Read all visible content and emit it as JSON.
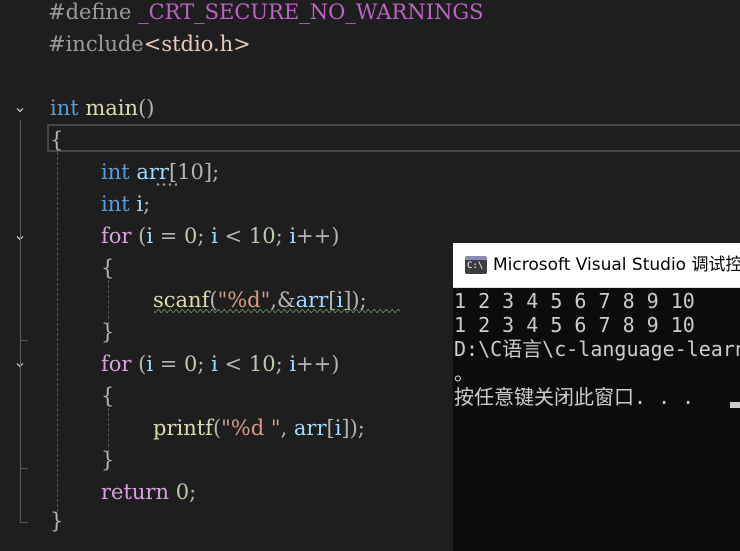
{
  "editor": {
    "lines": {
      "l1": {
        "a": "#define ",
        "b": "_CRT_SECURE_NO_WARNINGS"
      },
      "l2": {
        "a": "#include",
        "b": "<stdio.h>"
      },
      "l4": {
        "kw": "int",
        "fn": "main",
        "punc": "()"
      },
      "l5": {
        "punc": "{"
      },
      "l6": {
        "kw": "int",
        "var": "arr",
        "rest": "[10];"
      },
      "l7": {
        "kw": "int",
        "var": "i",
        "rest": ";"
      },
      "l8": {
        "kw": "for",
        "p1": " (",
        "v1": "i",
        "p2": " = ",
        "n1": "0",
        "p3": "; ",
        "v2": "i",
        "p4": " < ",
        "n2": "10",
        "p5": "; ",
        "v3": "i",
        "p6": "++)"
      },
      "l9": {
        "punc": "{"
      },
      "l10": {
        "fn": "scanf",
        "p1": "(",
        "str": "\"%d\"",
        "p2": ",&",
        "var": "arr",
        "p3": "[",
        "v2": "i",
        "p4": "]);"
      },
      "l11": {
        "punc": "}"
      },
      "l12": {
        "kw": "for",
        "p1": " (",
        "v1": "i",
        "p2": " = ",
        "n1": "0",
        "p3": "; ",
        "v2": "i",
        "p4": " < ",
        "n2": "10",
        "p5": "; ",
        "v3": "i",
        "p6": "++)"
      },
      "l13": {
        "punc": "{"
      },
      "l14": {
        "fn": "printf",
        "p1": "(",
        "str": "\"%d \"",
        "p2": ", ",
        "var": "arr",
        "p3": "[",
        "v2": "i",
        "p4": "]);"
      },
      "l15": {
        "punc": "}"
      },
      "l16": {
        "ctrl": "return",
        "p1": " ",
        "num": "0",
        "p2": ";"
      },
      "l17": {
        "punc": "}"
      }
    }
  },
  "console": {
    "title": "Microsoft Visual Studio 调试控制台",
    "icon": "console-app-icon",
    "icon_text": "C:\\",
    "output": [
      "1 2 3 4 5 6 7 8 9 10",
      "1 2 3 4 5 6 7 8 9 10",
      "D:\\C语言\\c-language-learning",
      "。",
      "按任意键关闭此窗口. . ."
    ]
  },
  "colors": {
    "editor_bg": "#1e1e1e",
    "keyword": "#569cd6",
    "control": "#d8a0df",
    "function": "#dcdcaa",
    "variable": "#9cdcfe",
    "string": "#d69d85",
    "number": "#b5cea8",
    "console_bg": "#0c0c0c"
  }
}
